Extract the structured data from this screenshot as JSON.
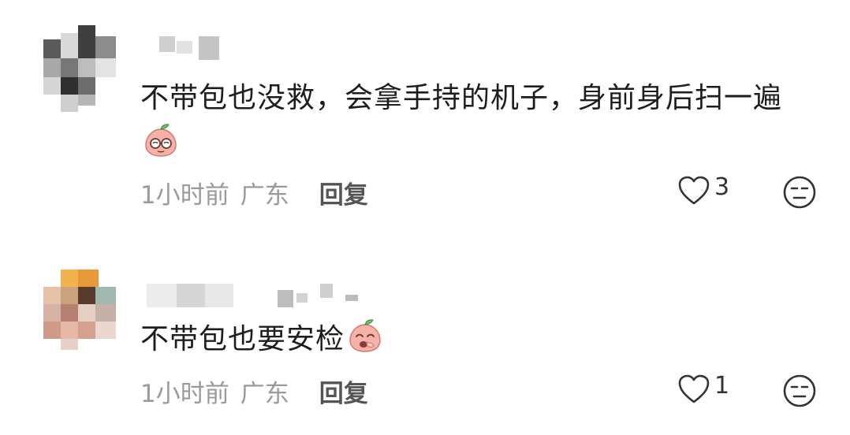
{
  "comments": [
    {
      "text": "不带包也没救，会拿手持的机子，身前身后扫一遍",
      "emoji": "peach-glasses-emoji",
      "time": "1小时前",
      "region": "广东",
      "reply_label": "回复",
      "likes": "3"
    },
    {
      "text": "不带包也要安检",
      "emoji": "peach-laugh-emoji",
      "time": "1小时前",
      "region": "广东",
      "reply_label": "回复",
      "likes": "1"
    }
  ],
  "icons": {
    "like": "heart-outline-icon",
    "dislike": "neutral-face-icon"
  },
  "colors": {
    "text": "#1d1d1d",
    "meta": "#9a9a9a",
    "reply": "#555555",
    "emoji_peach": "#f6b1a8"
  }
}
